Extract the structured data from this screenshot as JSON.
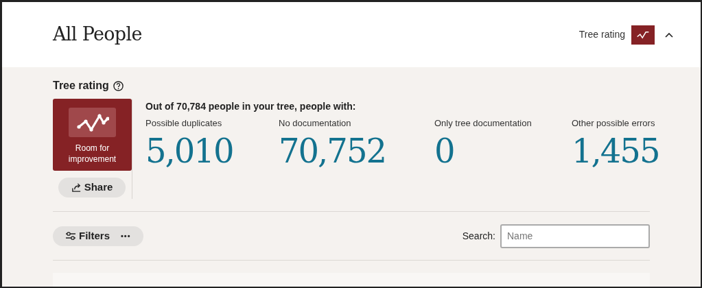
{
  "page_title": "All People",
  "header_toggle": {
    "label": "Tree rating",
    "expanded": true
  },
  "tree_rating": {
    "title": "Tree rating",
    "badge_label": "Room for improvement",
    "share_label": "Share",
    "summary": "Out of 70,784 people in your tree, people with:",
    "stats": [
      {
        "label": "Possible duplicates",
        "value": "5,010"
      },
      {
        "label": "No documentation",
        "value": "70,752"
      },
      {
        "label": "Only tree documentation",
        "value": "0"
      },
      {
        "label": "Other possible errors",
        "value": "1,455"
      }
    ]
  },
  "toolbar": {
    "filters_label": "Filters",
    "more_label": "•••",
    "search_label": "Search:",
    "search": {
      "placeholder": "Name"
    }
  }
}
